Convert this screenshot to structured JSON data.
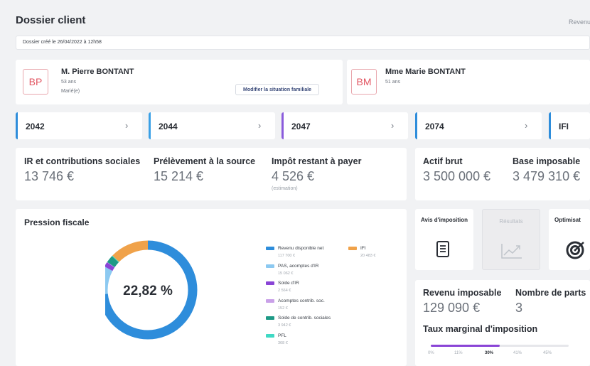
{
  "header": {
    "title": "Dossier client",
    "revenu_link": "Revenu",
    "created": "Dossier créé le 26/04/2022 à 12h58"
  },
  "clients": [
    {
      "initials": "BP",
      "name": "M. Pierre BONTANT",
      "age": "53 ans",
      "status": "Marié(e)",
      "action": "Modifier la situation familiale"
    },
    {
      "initials": "BM",
      "name": "Mme Marie BONTANT",
      "age": "51 ans"
    }
  ],
  "tabs": [
    {
      "label": "2042",
      "color": "#2e8ddb"
    },
    {
      "label": "2044",
      "color": "#3aa0e6"
    },
    {
      "label": "2047",
      "color": "#8a5bdc"
    },
    {
      "label": "2074",
      "color": "#2e8ddb"
    },
    {
      "label": "IFI",
      "color": "#2e8ddb"
    }
  ],
  "metrics": {
    "ir": {
      "label": "IR et contributions sociales",
      "value": "13 746 €"
    },
    "pas": {
      "label": "Prélèvement à la source",
      "value": "15 214 €"
    },
    "restant": {
      "label": "Impôt restant à payer",
      "value": "4 526 €",
      "note": "(estimation)"
    },
    "actif": {
      "label": "Actif brut",
      "value": "3 500 000 €"
    },
    "base": {
      "label": "Base imposable",
      "value": "3 479 310 €"
    }
  },
  "pression": {
    "title": "Pression fiscale",
    "percent": "22,82 %"
  },
  "chart_data": {
    "type": "pie",
    "title": "Pression fiscale",
    "center_label": "22,82 %",
    "series": [
      {
        "name": "Revenu disponible net",
        "value_label": "117 700 €",
        "value": 117700,
        "color": "#2e8ddb"
      },
      {
        "name": "PAS, acomptes d'IR",
        "value_label": "15 062 €",
        "value": 15062,
        "color": "#8cc9f1"
      },
      {
        "name": "Solde d'IR",
        "value_label": "2 564 €",
        "value": 2564,
        "color": "#8a44d6"
      },
      {
        "name": "Acomptes contrib. soc.",
        "value_label": "152 €",
        "value": 152,
        "color": "#c9a0e8"
      },
      {
        "name": "Solde de contrib. sociales",
        "value_label": "3 942 €",
        "value": 3942,
        "color": "#1e9a86"
      },
      {
        "name": "PFL",
        "value_label": "368 €",
        "value": 368,
        "color": "#3fd9c4"
      },
      {
        "name": "IFI",
        "value_label": "20 483 €",
        "value": 20483,
        "color": "#f0a24a"
      }
    ]
  },
  "tools": [
    {
      "label": "Avis d'imposition",
      "icon": "document-icon",
      "enabled": true
    },
    {
      "label": "Résultats",
      "icon": "trend-chart-icon",
      "enabled": false
    },
    {
      "label": "Optimisat",
      "icon": "target-icon",
      "enabled": true
    }
  ],
  "revenu": {
    "imposable_label": "Revenu imposable",
    "imposable_value": "129 090 €",
    "parts_label": "Nombre de parts",
    "parts_value": "3",
    "taux_label": "Taux marginal d'imposition",
    "taux_ticks": [
      "0%",
      "11%",
      "30%",
      "41%",
      "45%"
    ],
    "taux_current": "30%",
    "taux_fill": 0.5
  }
}
